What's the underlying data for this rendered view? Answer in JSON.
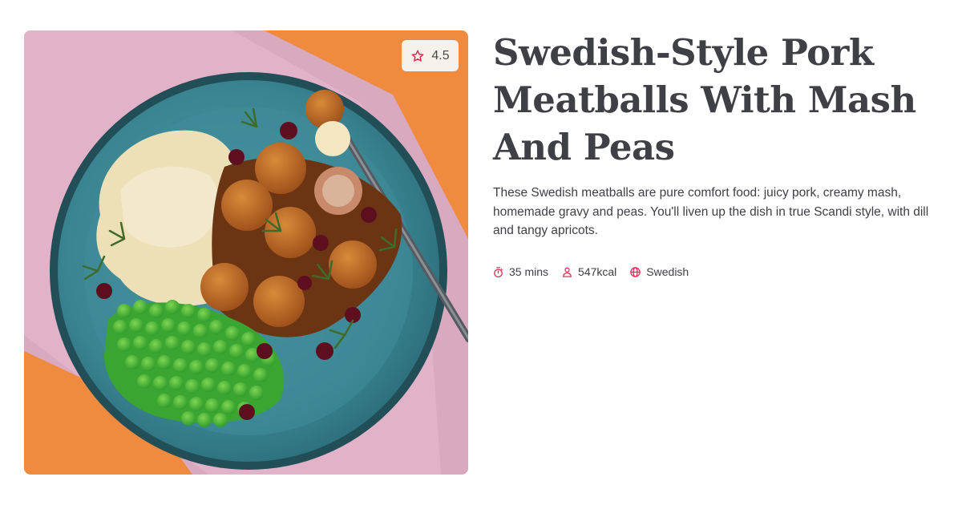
{
  "recipe": {
    "title": "Swedish-Style Pork Meatballs With Mash And Peas",
    "description": "These Swedish meatballs are pure comfort food: juicy pork, creamy mash, homemade gravy and peas. You'll liven up the dish in true Scandi style, with dill and tangy apricots.",
    "rating": "4.5",
    "meta": {
      "time": "35 mins",
      "calories": "547kcal",
      "cuisine": "Swedish"
    },
    "icons": {
      "rating": "star-icon",
      "time": "stopwatch-icon",
      "calories": "person-icon",
      "cuisine": "globe-icon"
    }
  },
  "colors": {
    "accent": "#e8284f",
    "title": "#3f3f46",
    "text": "#3f3f46",
    "rating_bg": "#f6f1ea"
  }
}
